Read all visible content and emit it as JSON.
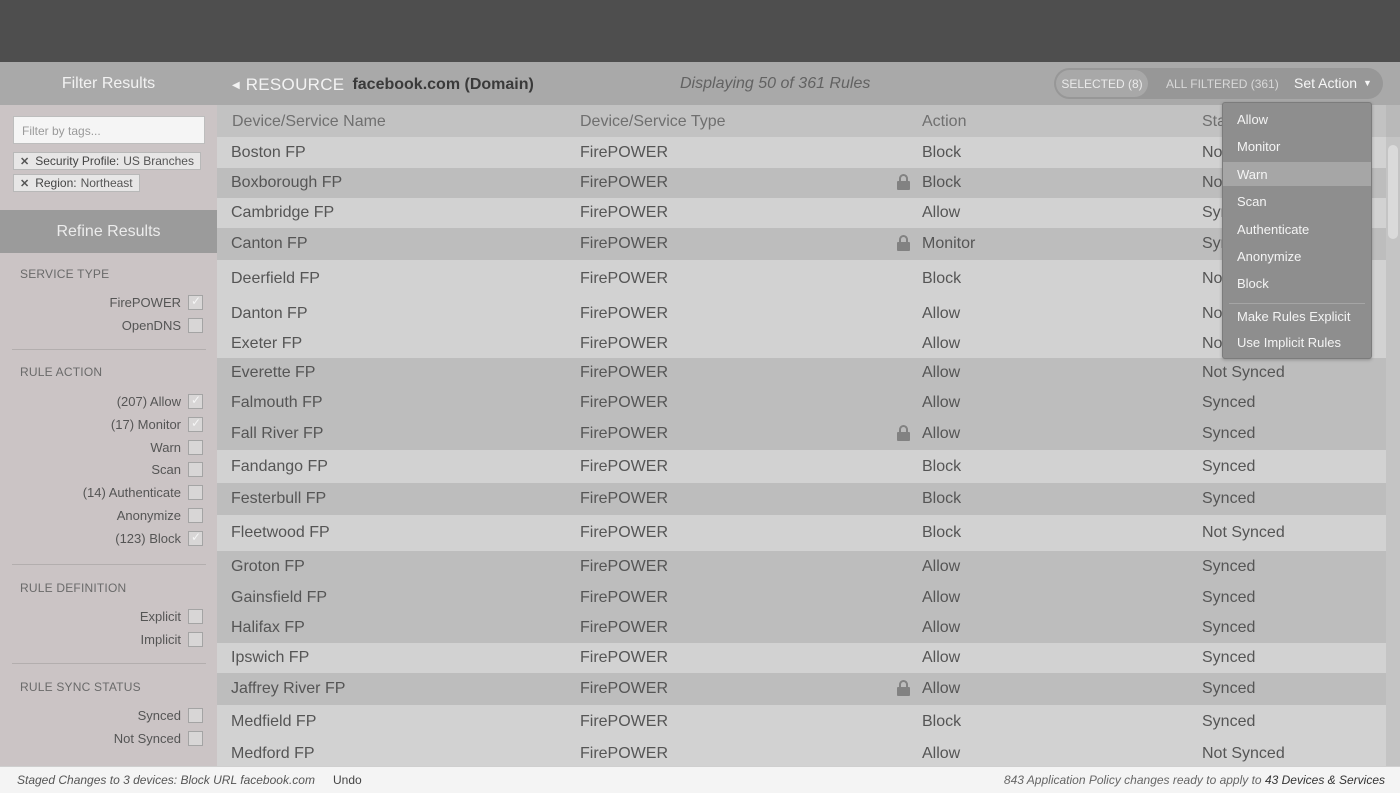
{
  "sidebar": {
    "title": "Filter Results",
    "tag_placeholder": "Filter by tags...",
    "chips": [
      {
        "key": "Security Profile:",
        "value": "US Branches"
      },
      {
        "key": "Region:",
        "value": "Northeast"
      }
    ],
    "refine_title": "Refine Results",
    "sections": {
      "service_type": {
        "title": "SERVICE TYPE",
        "options": [
          {
            "label": "FirePOWER",
            "checked": true
          },
          {
            "label": "OpenDNS",
            "checked": false
          }
        ]
      },
      "rule_action": {
        "title": "RULE ACTION",
        "options": [
          {
            "label": "(207) Allow",
            "checked": true
          },
          {
            "label": "(17) Monitor",
            "checked": true
          },
          {
            "label": "Warn",
            "checked": false
          },
          {
            "label": "Scan",
            "checked": false
          },
          {
            "label": "(14) Authenticate",
            "checked": false
          },
          {
            "label": "Anonymize",
            "checked": false
          },
          {
            "label": "(123) Block",
            "checked": true
          }
        ]
      },
      "rule_definition": {
        "title": "RULE DEFINITION",
        "options": [
          {
            "label": "Explicit",
            "checked": false
          },
          {
            "label": "Implicit",
            "checked": false
          }
        ]
      },
      "rule_sync": {
        "title": "RULE SYNC STATUS",
        "options": [
          {
            "label": "Synced",
            "checked": false
          },
          {
            "label": "Not Synced",
            "checked": false
          }
        ]
      }
    }
  },
  "header": {
    "resource_label": "RESOURCE",
    "resource_value": "facebook.com (Domain)",
    "displaying": "Displaying 50 of 361 Rules",
    "selected": "SELECTED (8)",
    "all_filtered": "ALL FILTERED (361)",
    "set_action": "Set Action"
  },
  "table": {
    "columns": [
      "Device/Service Name",
      "Device/Service Type",
      "Action",
      "Status"
    ],
    "rows": [
      {
        "name": "Boston FP",
        "type": "FirePOWER",
        "action": "Block",
        "status": "Not Synced",
        "locked": false
      },
      {
        "name": "Boxborough FP",
        "type": "FirePOWER",
        "action": "Block",
        "status": "Not Synced",
        "locked": true
      },
      {
        "name": "Cambridge FP",
        "type": "FirePOWER",
        "action": "Allow",
        "status": "Synced",
        "locked": false
      },
      {
        "name": "Canton FP",
        "type": "FirePOWER",
        "action": "Monitor",
        "status": "Synced",
        "locked": true
      },
      {
        "name": "Deerfield FP",
        "type": "FirePOWER",
        "action": "Block",
        "status": "Not Synced",
        "locked": false
      },
      {
        "name": "Danton FP",
        "type": "FirePOWER",
        "action": "Allow",
        "status": "Not Synced",
        "locked": false
      },
      {
        "name": "Exeter FP",
        "type": "FirePOWER",
        "action": "Allow",
        "status": "Not Synced",
        "locked": false
      },
      {
        "name": "Everette FP",
        "type": "FirePOWER",
        "action": "Allow",
        "status": "Not Synced",
        "locked": false
      },
      {
        "name": "Falmouth FP",
        "type": "FirePOWER",
        "action": "Allow",
        "status": "Synced",
        "locked": false
      },
      {
        "name": "Fall River FP",
        "type": "FirePOWER",
        "action": "Allow",
        "status": "Synced",
        "locked": true
      },
      {
        "name": "Fandango FP",
        "type": "FirePOWER",
        "action": "Block",
        "status": "Synced",
        "locked": false
      },
      {
        "name": "Festerbull FP",
        "type": "FirePOWER",
        "action": "Block",
        "status": "Synced",
        "locked": false
      },
      {
        "name": "Fleetwood FP",
        "type": "FirePOWER",
        "action": "Block",
        "status": "Not Synced",
        "locked": false
      },
      {
        "name": "Groton FP",
        "type": "FirePOWER",
        "action": "Allow",
        "status": "Synced",
        "locked": false
      },
      {
        "name": "Gainsfield FP",
        "type": "FirePOWER",
        "action": "Allow",
        "status": "Synced",
        "locked": false
      },
      {
        "name": "Halifax FP",
        "type": "FirePOWER",
        "action": "Allow",
        "status": "Synced",
        "locked": false
      },
      {
        "name": "Ipswich FP",
        "type": "FirePOWER",
        "action": "Allow",
        "status": "Synced",
        "locked": false
      },
      {
        "name": "Jaffrey River FP",
        "type": "FirePOWER",
        "action": "Allow",
        "status": "Synced",
        "locked": true
      },
      {
        "name": "Medfield FP",
        "type": "FirePOWER",
        "action": "Block",
        "status": "Synced",
        "locked": false
      },
      {
        "name": "Medford FP",
        "type": "FirePOWER",
        "action": "Allow",
        "status": "Not Synced",
        "locked": false
      }
    ]
  },
  "dropdown": {
    "items": [
      "Allow",
      "Monitor",
      "Warn",
      "Scan",
      "Authenticate",
      "Anonymize",
      "Block"
    ],
    "highlighted": "Warn",
    "extra_items": [
      "Make Rules Explicit",
      "Use Implicit Rules"
    ]
  },
  "footer": {
    "staged": "Staged Changes to 3 devices:  Block URL facebook.com",
    "undo": "Undo",
    "summary_prefix": "843 Application Policy changes ready to apply to",
    "summary_target": "43 Devices & Services"
  }
}
